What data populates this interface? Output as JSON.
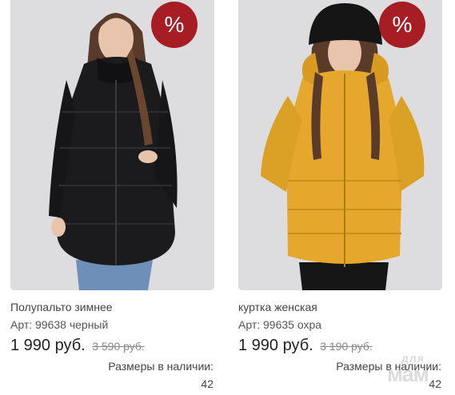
{
  "products": [
    {
      "badge": "%",
      "title": "Полупальто зимнее",
      "article": "Арт: 99638 черный",
      "price": "1 990 руб.",
      "old_price": "3 590 руб.",
      "sizes_label": "Размеры в наличии:",
      "sizes": "42",
      "jacket_color": "#1b1b1d"
    },
    {
      "badge": "%",
      "title": "куртка женская",
      "article": "Арт: 99635 охра",
      "price": "1 990 руб.",
      "old_price": "3 190 руб.",
      "sizes_label": "Размеры в наличии:",
      "sizes": "42",
      "jacket_color": "#e5a72c"
    }
  ],
  "watermark": {
    "line1": "для",
    "line2": "мам"
  },
  "colors": {
    "badge": "#a61e24",
    "photo_background": "#dcdcde"
  }
}
